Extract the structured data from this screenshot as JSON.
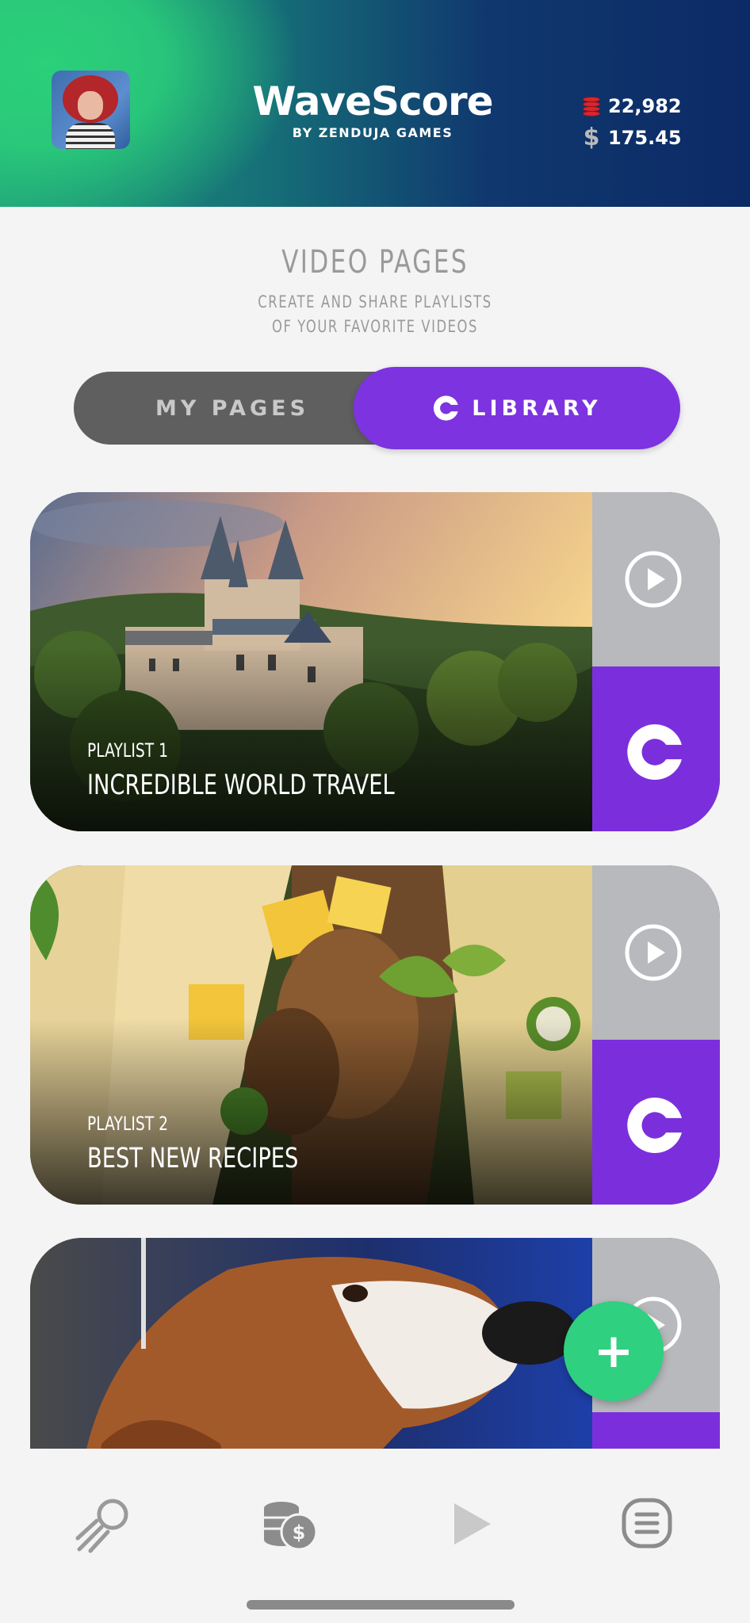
{
  "header": {
    "brand_title": "WaveScore",
    "brand_subtitle": "BY ZENDUJA GAMES",
    "coins": "22,982",
    "cash": "175.45",
    "colors": {
      "gradient_start": "#2bd07a",
      "gradient_end": "#0c2a66"
    }
  },
  "page": {
    "title": "VIDEO PAGES",
    "subtitle_line1": "CREATE AND SHARE PLAYLISTS",
    "subtitle_line2": "OF YOUR FAVORITE VIDEOS"
  },
  "toggle": {
    "my_pages_label": "MY PAGES",
    "library_label": "LIBRARY",
    "selected": "LIBRARY",
    "accent_color": "#7d33e0"
  },
  "playlists": [
    {
      "kicker": "PLAYLIST 1",
      "title": "INCREDIBLE WORLD TRAVEL",
      "image": "castle-landscape"
    },
    {
      "kicker": "PLAYLIST 2",
      "title": "BEST NEW RECIPES",
      "image": "tacos"
    },
    {
      "kicker": "",
      "title": "",
      "image": "basset-hound-dog"
    }
  ],
  "fab": {
    "label": "+",
    "color": "#2fd07f"
  },
  "bottom_nav": {
    "items": [
      "meteor-icon",
      "coins-dollar-icon",
      "play-icon",
      "menu-list-icon"
    ]
  }
}
